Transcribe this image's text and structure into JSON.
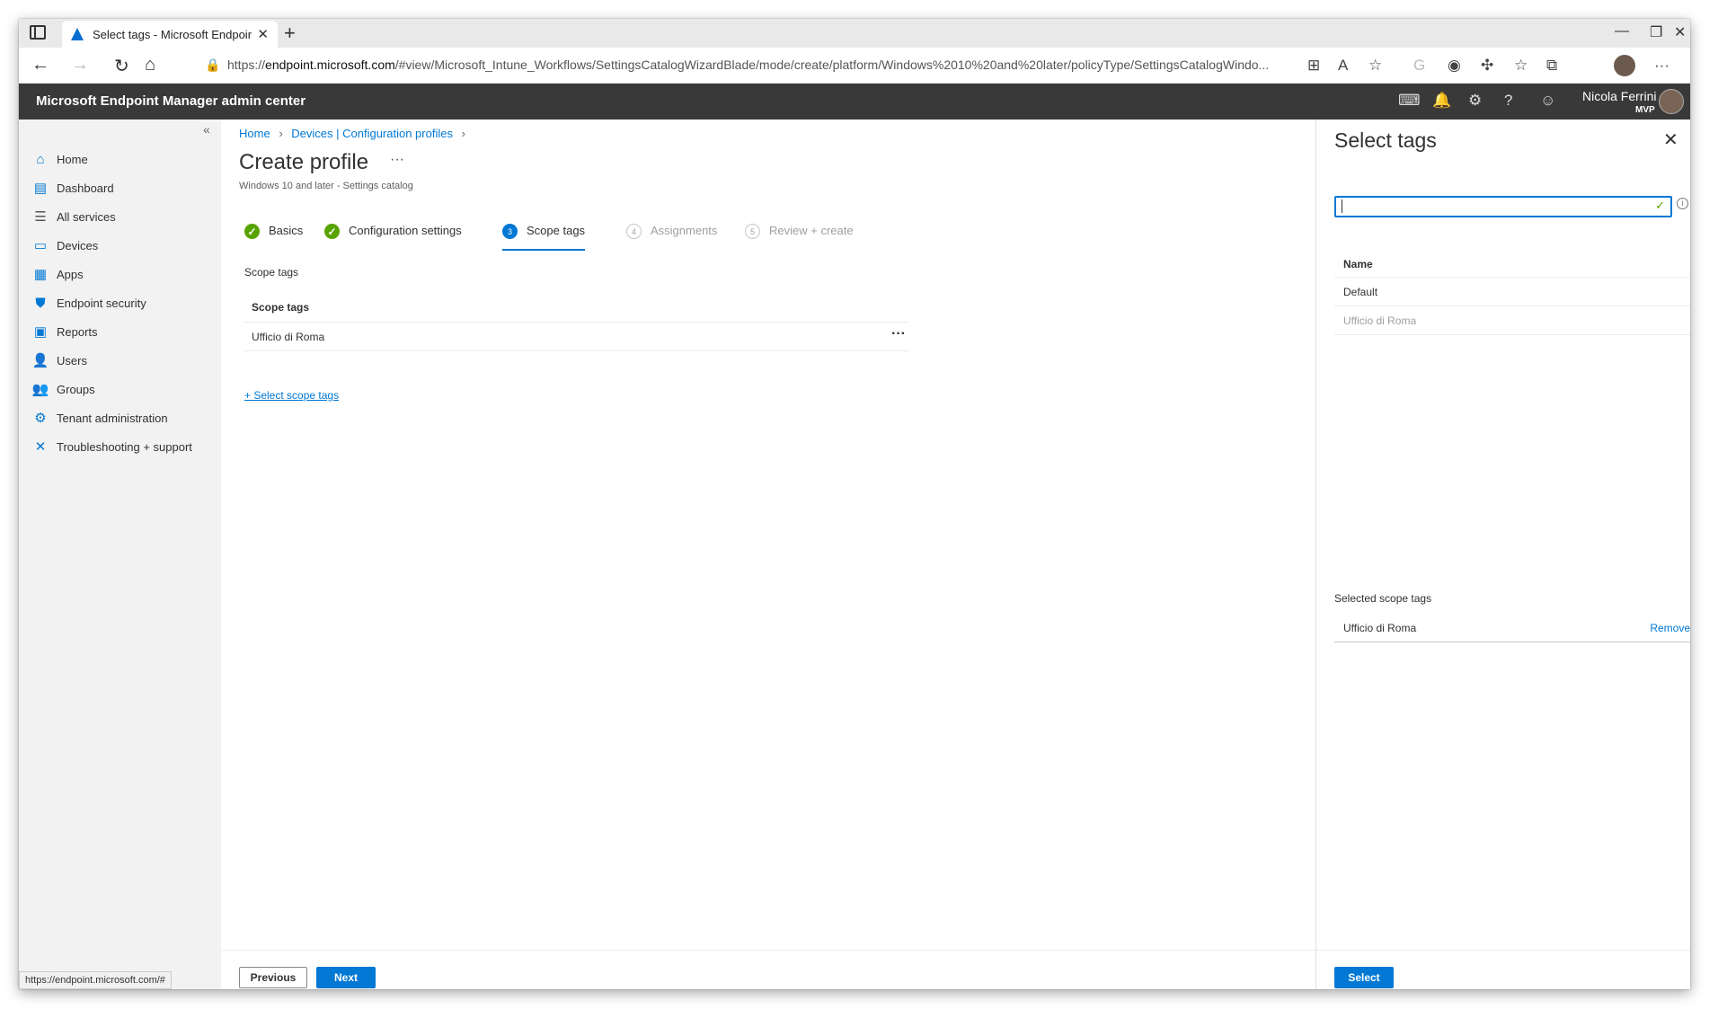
{
  "browser": {
    "tab_title": "Select tags - Microsoft Endpoint",
    "url_prefix": "https://",
    "url_host": "endpoint.microsoft.com",
    "url_rest": "/#view/Microsoft_Intune_Workflows/SettingsCatalogWizardBlade/mode/create/platform/Windows%2010%20and%20later/policyType/SettingsCatalogWindo...",
    "status_url": "https://endpoint.microsoft.com/#"
  },
  "portal": {
    "title": "Microsoft Endpoint Manager admin center",
    "user_name": "Nicola Ferrini",
    "user_badge": "MVP"
  },
  "sidebar": {
    "items": [
      {
        "label": "Home",
        "icon": "home-icon"
      },
      {
        "label": "Dashboard",
        "icon": "dashboard-icon"
      },
      {
        "label": "All services",
        "icon": "list-icon"
      },
      {
        "label": "Devices",
        "icon": "devices-icon"
      },
      {
        "label": "Apps",
        "icon": "apps-grid-icon"
      },
      {
        "label": "Endpoint security",
        "icon": "shield-icon"
      },
      {
        "label": "Reports",
        "icon": "reports-icon"
      },
      {
        "label": "Users",
        "icon": "user-icon"
      },
      {
        "label": "Groups",
        "icon": "groups-icon"
      },
      {
        "label": "Tenant administration",
        "icon": "tenant-admin-icon"
      },
      {
        "label": "Troubleshooting + support",
        "icon": "wrench-icon"
      }
    ]
  },
  "main": {
    "breadcrumb": [
      "Home",
      "Devices | Configuration profiles"
    ],
    "title": "Create profile",
    "subtitle": "Windows 10 and later - Settings catalog",
    "steps": [
      {
        "num": "1",
        "label": "Basics",
        "state": "done"
      },
      {
        "num": "2",
        "label": "Configuration settings",
        "state": "done"
      },
      {
        "num": "3",
        "label": "Scope tags",
        "state": "current"
      },
      {
        "num": "4",
        "label": "Assignments",
        "state": "todo"
      },
      {
        "num": "5",
        "label": "Review + create",
        "state": "todo"
      }
    ],
    "section_label": "Scope tags",
    "table_header": "Scope tags",
    "table_rows": [
      "Ufficio di Roma"
    ],
    "add_link": "+ Select scope tags",
    "previous_label": "Previous",
    "next_label": "Next"
  },
  "blade": {
    "title": "Select tags",
    "search_value": "",
    "table_header": "Name",
    "rows": [
      {
        "name": "Default",
        "disabled": false
      },
      {
        "name": "Ufficio di Roma",
        "disabled": true
      }
    ],
    "selected_label": "Selected scope tags",
    "selected_items": [
      "Ufficio di Roma"
    ],
    "remove_label": "Remove",
    "select_label": "Select"
  },
  "colors": {
    "accent": "#0078d4",
    "success": "#57a300",
    "header_bg": "#393939",
    "sidebar_bg": "#f2f2f2"
  }
}
